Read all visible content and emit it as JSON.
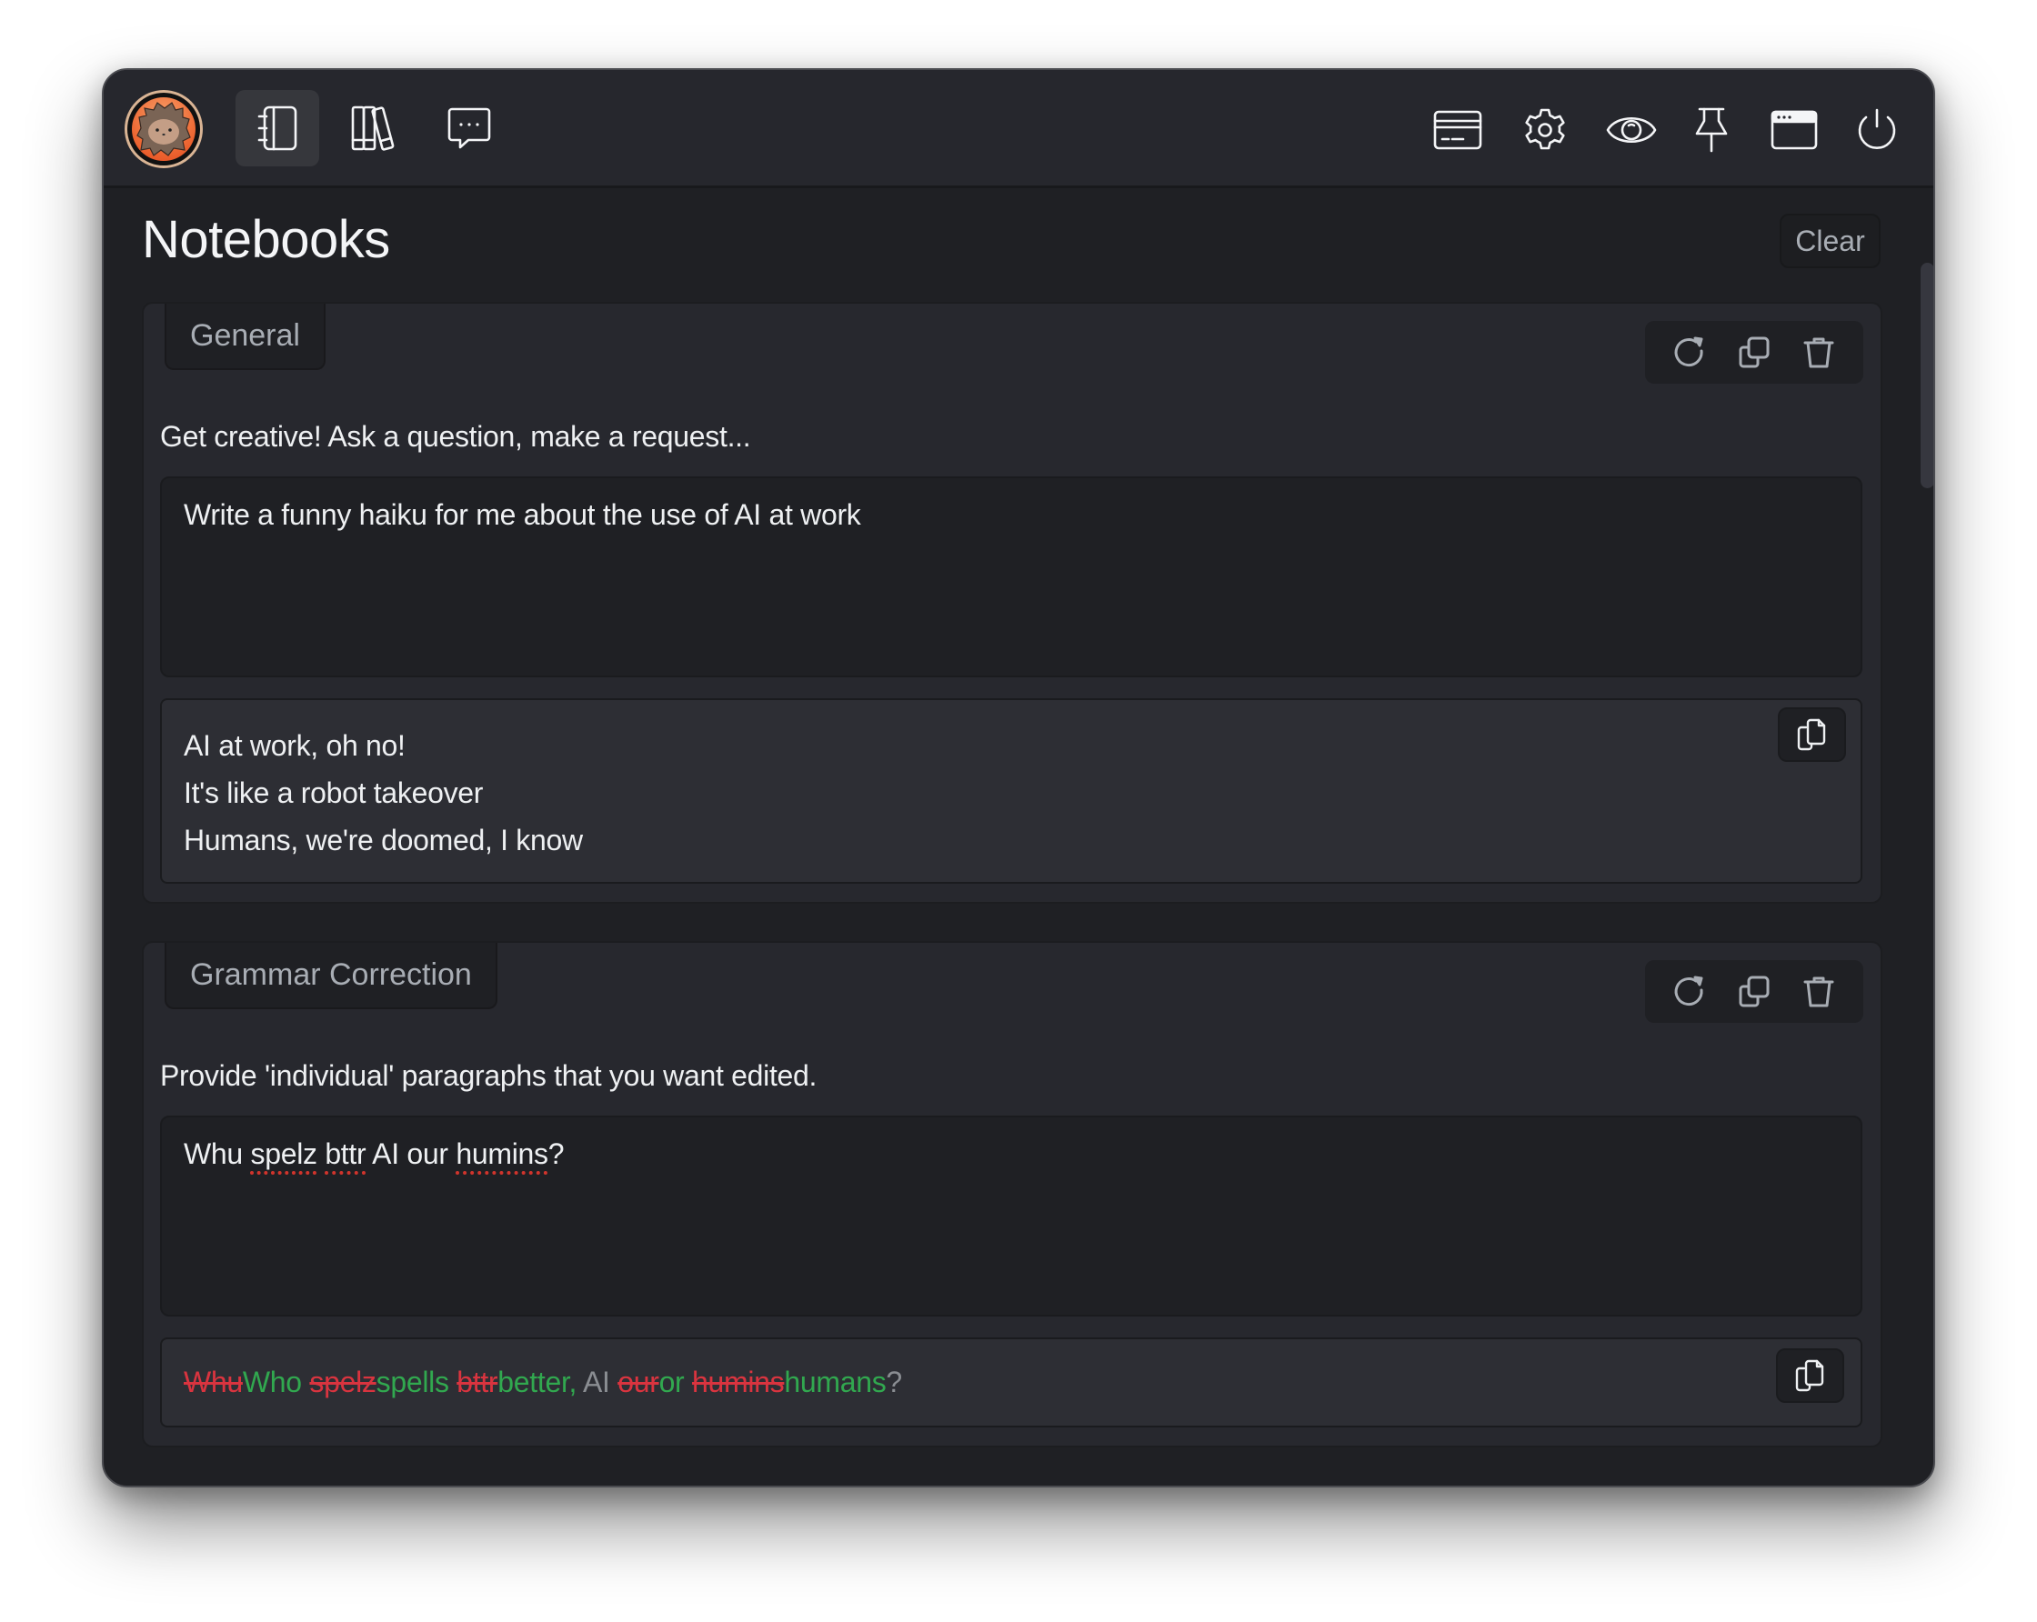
{
  "header": {
    "nav": [
      {
        "name": "notebooks",
        "icon": "notebook-icon",
        "active": true
      },
      {
        "name": "library",
        "icon": "books-icon",
        "active": false
      },
      {
        "name": "chat",
        "icon": "chat-icon",
        "active": false
      }
    ],
    "tools": [
      {
        "name": "card",
        "icon": "credit-card-icon"
      },
      {
        "name": "settings",
        "icon": "gear-icon"
      },
      {
        "name": "visibility",
        "icon": "eye-icon"
      },
      {
        "name": "pin",
        "icon": "pin-icon"
      },
      {
        "name": "window",
        "icon": "browser-window-icon"
      },
      {
        "name": "power",
        "icon": "power-icon"
      }
    ]
  },
  "page": {
    "title": "Notebooks",
    "clear_label": "Clear"
  },
  "notebooks": [
    {
      "tab": "General",
      "description": "Get creative! Ask a question, make a request...",
      "prompt": "Write a funny haiku for me about the use of AI at work",
      "output_lines": [
        "AI at work, oh no!",
        "It's like a robot takeover",
        "Humans, we're doomed, I know"
      ]
    },
    {
      "tab": "Grammar Correction",
      "description": "Provide 'individual' paragraphs that you want edited.",
      "prompt_tokens": [
        {
          "text": "Whu ",
          "misspelled": false
        },
        {
          "text": "spelz",
          "misspelled": true
        },
        {
          "text": " ",
          "misspelled": false
        },
        {
          "text": "bttr",
          "misspelled": true
        },
        {
          "text": " AI our ",
          "misspelled": false
        },
        {
          "text": "humins",
          "misspelled": true
        },
        {
          "text": "?",
          "misspelled": false
        }
      ],
      "diff": [
        {
          "type": "del",
          "text": "Whu"
        },
        {
          "type": "ins",
          "text": "Who "
        },
        {
          "type": "del",
          "text": "spelz"
        },
        {
          "type": "ins",
          "text": "spells "
        },
        {
          "type": "del",
          "text": "bttr"
        },
        {
          "type": "ins",
          "text": "better,"
        },
        {
          "type": "same",
          "text": " AI "
        },
        {
          "type": "del",
          "text": "our"
        },
        {
          "type": "ins",
          "text": "or "
        },
        {
          "type": "del",
          "text": "humins"
        },
        {
          "type": "ins",
          "text": "humans"
        },
        {
          "type": "same",
          "text": "?"
        }
      ]
    }
  ],
  "colors": {
    "deleted": "#d9343f",
    "inserted": "#31a84f",
    "unchanged": "#8a8d92",
    "spellcheck": "#d0342c"
  }
}
